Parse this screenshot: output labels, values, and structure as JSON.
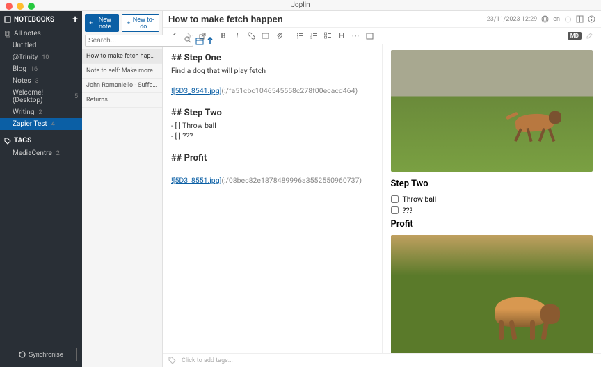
{
  "app": {
    "title": "Joplin"
  },
  "sidebar": {
    "notebooks_header": "NOTEBOOKS",
    "all_notes": "All notes",
    "items": [
      {
        "label": "Untitled",
        "count": ""
      },
      {
        "label": "@Trinity",
        "count": "10"
      },
      {
        "label": "Blog",
        "count": "16"
      },
      {
        "label": "Notes",
        "count": "3"
      },
      {
        "label": "Welcome! (Desktop)",
        "count": "5"
      },
      {
        "label": "Writing",
        "count": "2"
      },
      {
        "label": "Zapier Test",
        "count": "4"
      }
    ],
    "tags_header": "TAGS",
    "tags": [
      {
        "label": "MediaCentre",
        "count": "2"
      }
    ],
    "sync_label": "Synchronise"
  },
  "notelist": {
    "new_note": "New note",
    "new_todo": "New to-do",
    "search_placeholder": "Search...",
    "items": [
      "How to make fetch happen",
      "Note to self: Make more notes to self",
      "John Romaniello - Suffer no fools",
      "Returns"
    ]
  },
  "note": {
    "title": "How to make fetch happen",
    "date": "23/11/2023 12:29",
    "lang": "en",
    "md_label": "MD",
    "src": {
      "h1": "## Step One",
      "l1": "Find a dog that will play fetch",
      "img1_label": "![5D3_8541.jpg]",
      "img1_hash": "(:/fa51cbc1046545558c278f00ecacd464)",
      "h2": "## Step Two",
      "t1_prefix": "- [ ] ",
      "t1": "Throw ball",
      "t2_prefix": "- [ ] ",
      "t2": "???",
      "h3": "## Profit",
      "img2_label": "![5D3_8551.jpg]",
      "img2_hash": "(:/08bec82e1878489996a3552550960737)"
    },
    "preview": {
      "h2": "Step Two",
      "chk1": "Throw ball",
      "chk2": "???",
      "h3": "Profit"
    },
    "tags_placeholder": "Click to add tags..."
  }
}
